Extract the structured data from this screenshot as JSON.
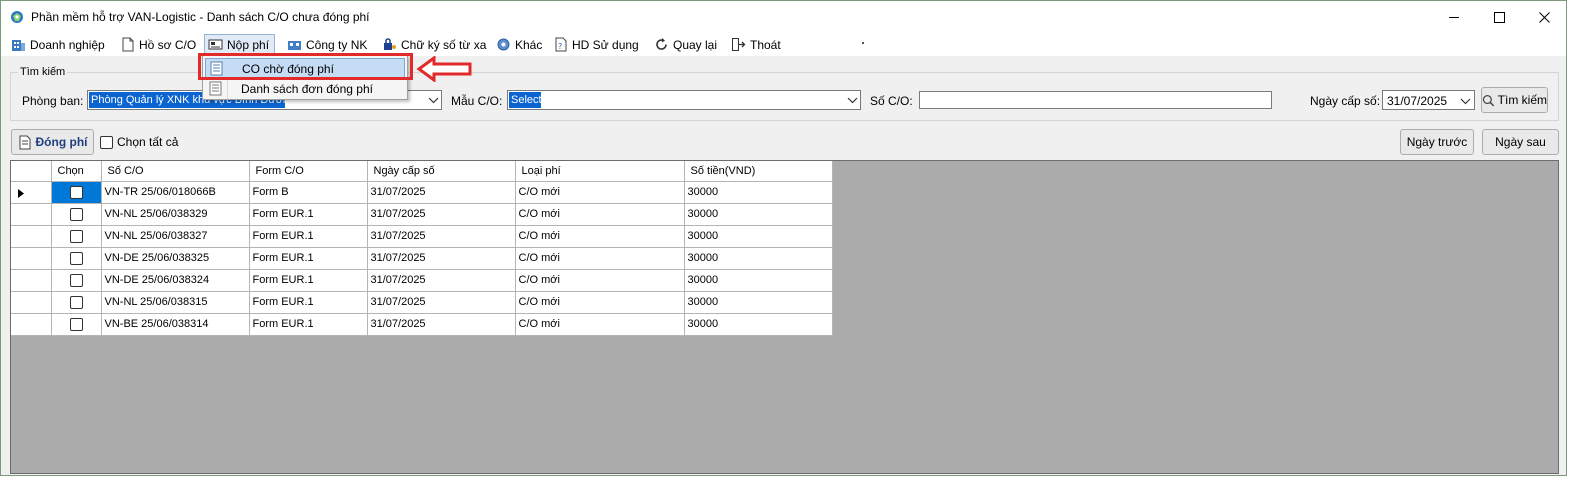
{
  "window": {
    "title": "Phần mềm hỗ trợ VAN-Logistic - Danh sách C/O chưa đóng phí",
    "icons": {
      "minimize": "minimize-icon",
      "maximize": "maximize-icon",
      "close": "close-icon"
    }
  },
  "menu": {
    "items": [
      {
        "label": "Doanh nghiệp",
        "icon": "building-icon"
      },
      {
        "label": "Hồ sơ C/O",
        "icon": "document-icon"
      },
      {
        "label": "Nộp phí",
        "icon": "payment-icon"
      },
      {
        "label": "Công ty NK",
        "icon": "company-icon"
      },
      {
        "label": "Chữ ký số từ xa",
        "icon": "lock-key-icon"
      },
      {
        "label": "Khác",
        "icon": "gear-icon"
      },
      {
        "label": "HD Sử dụng",
        "icon": "help-icon"
      },
      {
        "label": "Quay lại",
        "icon": "refresh-icon"
      },
      {
        "label": "Thoát",
        "icon": "exit-icon"
      }
    ],
    "dropdown": [
      {
        "label": "CO chờ đóng phí",
        "highlighted": true
      },
      {
        "label": "Danh sách đơn đóng phí",
        "highlighted": false
      }
    ]
  },
  "search": {
    "legend": "Tìm kiếm",
    "department_label": "Phòng ban:",
    "department_value": "Phòng Quản lý XNK khu vực Bình Dương",
    "form_label": "Mẫu C/O:",
    "form_value": "Select",
    "number_label": "Số C/O:",
    "number_value": "",
    "date_label": "Ngày cấp số:",
    "date_value": "31/07/2025",
    "search_button": "Tìm kiếm"
  },
  "actions": {
    "pay_button": "Đóng phí",
    "select_all": "Chọn tất cả",
    "prev_day": "Ngày trước",
    "next_day": "Ngày sau"
  },
  "grid": {
    "columns": [
      "Chọn",
      "Số C/O",
      "Form C/O",
      "Ngày cấp số",
      "Loại phí",
      "Số tiền(VND)"
    ],
    "rows": [
      {
        "so_co": "VN-TR 25/06/018066B",
        "form": "Form B",
        "ngay": "31/07/2025",
        "loai": "C/O mới",
        "tien": "30000"
      },
      {
        "so_co": "VN-NL 25/06/038329",
        "form": "Form EUR.1",
        "ngay": "31/07/2025",
        "loai": "C/O mới",
        "tien": "30000"
      },
      {
        "so_co": "VN-NL 25/06/038327",
        "form": "Form EUR.1",
        "ngay": "31/07/2025",
        "loai": "C/O mới",
        "tien": "30000"
      },
      {
        "so_co": "VN-DE 25/06/038325",
        "form": "Form EUR.1",
        "ngay": "31/07/2025",
        "loai": "C/O mới",
        "tien": "30000"
      },
      {
        "so_co": "VN-DE 25/06/038324",
        "form": "Form EUR.1",
        "ngay": "31/07/2025",
        "loai": "C/O mới",
        "tien": "30000"
      },
      {
        "so_co": "VN-NL 25/06/038315",
        "form": "Form EUR.1",
        "ngay": "31/07/2025",
        "loai": "C/O mới",
        "tien": "30000"
      },
      {
        "so_co": "VN-BE 25/06/038314",
        "form": "Form EUR.1",
        "ngay": "31/07/2025",
        "loai": "C/O mới",
        "tien": "30000"
      }
    ]
  },
  "colors": {
    "annotation": "#e22a2a",
    "selection": "#0078d7",
    "grid_background": "#ababab"
  }
}
